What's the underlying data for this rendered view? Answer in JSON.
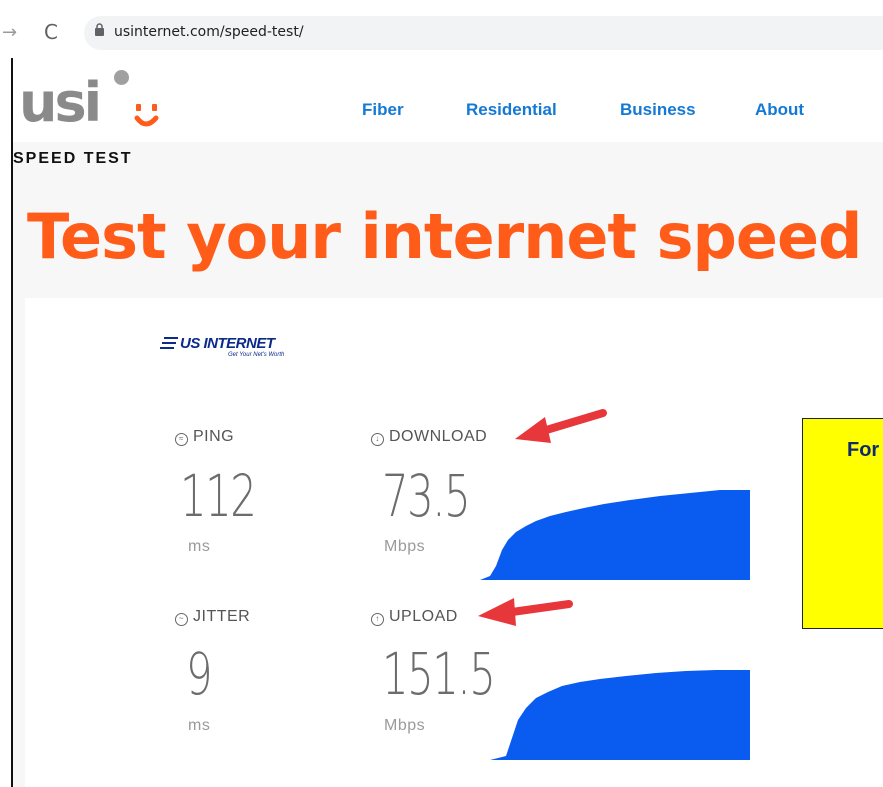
{
  "browser": {
    "forward_icon": "arrow-right-icon",
    "reload_icon": "reload-icon",
    "lock_icon": "lock-icon",
    "url": "usinternet.com/speed-test/"
  },
  "header": {
    "logo_text": "usi",
    "nav": [
      "Fiber",
      "Residential",
      "Business",
      "About"
    ],
    "subhead": "SPEED TEST"
  },
  "hero": {
    "title": "Test your internet speed"
  },
  "speedtest": {
    "brand": "US INTERNET",
    "brand_tagline": "Get Your Net's Worth",
    "ping": {
      "label": "PING",
      "value": "112",
      "unit": "ms"
    },
    "download": {
      "label": "DOWNLOAD",
      "value": "73.5",
      "unit": "Mbps"
    },
    "jitter": {
      "label": "JITTER",
      "value": "9",
      "unit": "ms"
    },
    "upload": {
      "label": "UPLOAD",
      "value": "151.5",
      "unit": "Mbps"
    }
  },
  "callout": {
    "text": "For"
  },
  "colors": {
    "accent": "#ff5c1a",
    "nav": "#1479d4",
    "graph": "#0a5cf0",
    "arrow": "#e8373a",
    "callout": "#ffff00"
  }
}
